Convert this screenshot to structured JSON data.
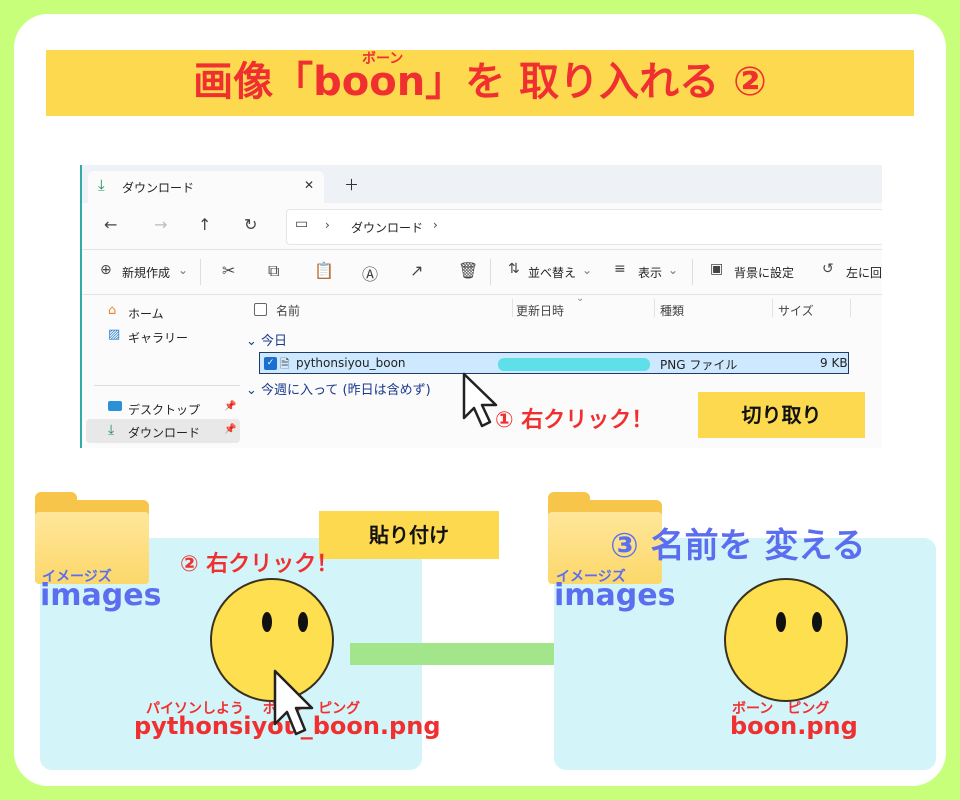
{
  "title": {
    "prefix": "画像「",
    "word": "boon",
    "suffix": "」を 取り入れる ②",
    "word_ruby": "ボーン"
  },
  "explorer": {
    "tab_label": "ダウンロード",
    "tab_close": "✕",
    "tab_new": "＋",
    "breadcrumb": [
      "ダウンロード"
    ],
    "toolbar": {
      "new_label": "新規作成",
      "sort_label": "並べ替え",
      "view_label": "表示",
      "wallpaper_label": "背景に設定",
      "rotate_label": "左に回"
    },
    "sidebar": {
      "home": "ホーム",
      "gallery": "ギャラリー",
      "desktop": "デスクトップ",
      "downloads": "ダウンロード"
    },
    "columns": {
      "name": "名前",
      "modified": "更新日時",
      "type": "種類",
      "size": "サイズ"
    },
    "groups": {
      "today": "今日",
      "this_week": "今週に入って (昨日は含めず)"
    },
    "file": {
      "name": "pythonsiyou_boon",
      "type": "PNG ファイル",
      "size": "9 KB"
    }
  },
  "steps": {
    "step1": "① 右クリック！",
    "cut_label": "切り取り",
    "step2": "② 右クリック！",
    "paste_label": "貼り付け",
    "step3": "③ 名前を 変える"
  },
  "left_panel": {
    "folder_ruby": "イメージズ",
    "folder_name": "images",
    "file_ruby": "パイソンしよう　 ボーン　ピング",
    "file_name": "pythonsiyou_boon.png"
  },
  "right_panel": {
    "folder_ruby": "イメージズ",
    "folder_name": "images",
    "file_ruby": "ボーン　ピング",
    "file_name": "boon.png"
  },
  "colors": {
    "background": "#c8ff7a",
    "title_bg": "#fdd94f",
    "title_text": "#f03030",
    "panel_bg": "#d3f4f8",
    "accent_blue": "#5b6ef0",
    "arrow_green": "#a2e58a"
  }
}
